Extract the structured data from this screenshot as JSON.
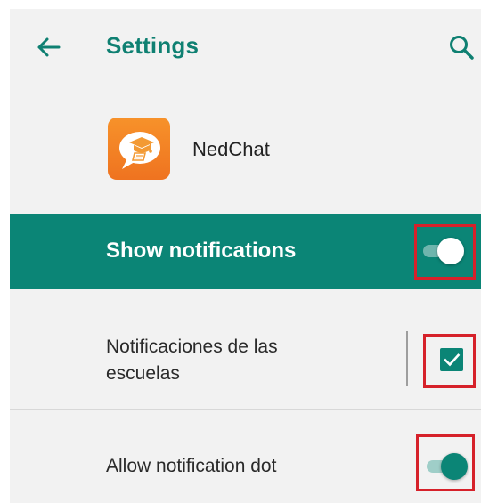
{
  "header": {
    "title": "Settings",
    "back_icon": "arrow-left-icon",
    "search_icon": "search-icon",
    "accent_color": "#0f8072"
  },
  "app": {
    "name": "NedChat",
    "icon": "nedchat-app-icon",
    "icon_color": "#f7922a"
  },
  "show_notifications": {
    "label": "Show notifications",
    "enabled": true,
    "background_color": "#0b8576"
  },
  "rows": [
    {
      "label": "Notificaciones de las escuelas",
      "control": "checkbox",
      "checked": true
    },
    {
      "label": "Allow notification dot",
      "control": "switch",
      "enabled": true
    }
  ],
  "highlight_color": "#d6212a"
}
